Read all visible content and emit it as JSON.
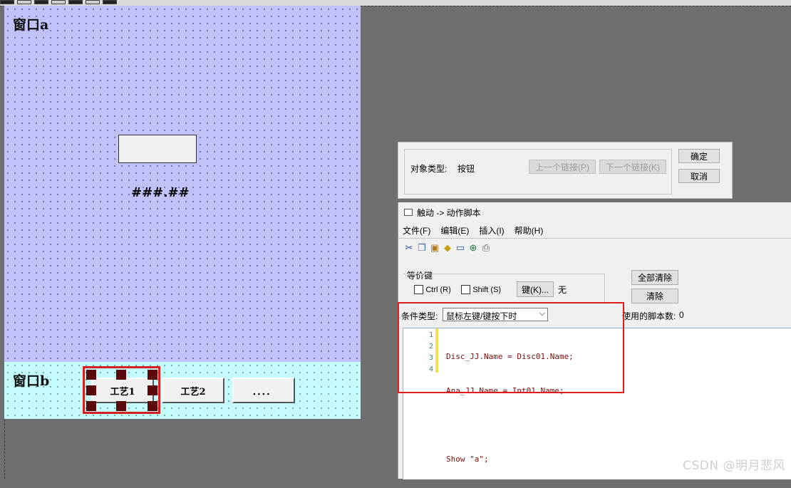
{
  "canvas": {
    "window_a": {
      "title": "窗口a",
      "numeric_display": "###.##",
      "bg_color": "#c2c2fb"
    },
    "window_b": {
      "title": "窗口b",
      "bg_color": "#c4fbfb",
      "buttons": [
        {
          "label": "工艺1",
          "selected": true
        },
        {
          "label": "工艺2",
          "selected": false
        },
        {
          "label": "．．．．",
          "selected": false
        }
      ]
    }
  },
  "link_dialog": {
    "object_type_label": "对象类型:",
    "object_type_value": "按钮",
    "prev_link": "上一个链接(P)",
    "next_link": "下一个链接(K)",
    "ok": "确定",
    "cancel": "取消"
  },
  "script_dialog": {
    "title": "触动 -> 动作脚本",
    "menu": [
      "文件(F)",
      "编辑(E)",
      "插入(I)",
      "帮助(H)"
    ],
    "toolbar_icons": [
      "cut-icon",
      "copy-icon",
      "paste-icon",
      "tag-icon",
      "window-icon",
      "link-icon",
      "print-icon"
    ],
    "equivalent_key": {
      "label": "等价键",
      "ctrl": "Ctrl (R)",
      "shift": "Shift (S)",
      "key_button": "键(K)...",
      "key_value": "无"
    },
    "clear_all": "全部清除",
    "clear": "清除",
    "condition_label": "条件类型:",
    "condition_value": "鼠标左键/键按下时",
    "script_count_label": "使用的脚本数:",
    "script_count_value": "0",
    "code": {
      "line_numbers": [
        "1",
        "2",
        "3",
        "4"
      ],
      "lines": [
        "Disc_JJ.Name = Disc01.Name;",
        "Ana_JJ.Name = Int01.Name;",
        "",
        "Show \"a\";"
      ]
    }
  },
  "watermark": "CSDN @明月悲风",
  "colors": {
    "highlight_red": "#e01c1c",
    "code_text": "#7a1010"
  }
}
